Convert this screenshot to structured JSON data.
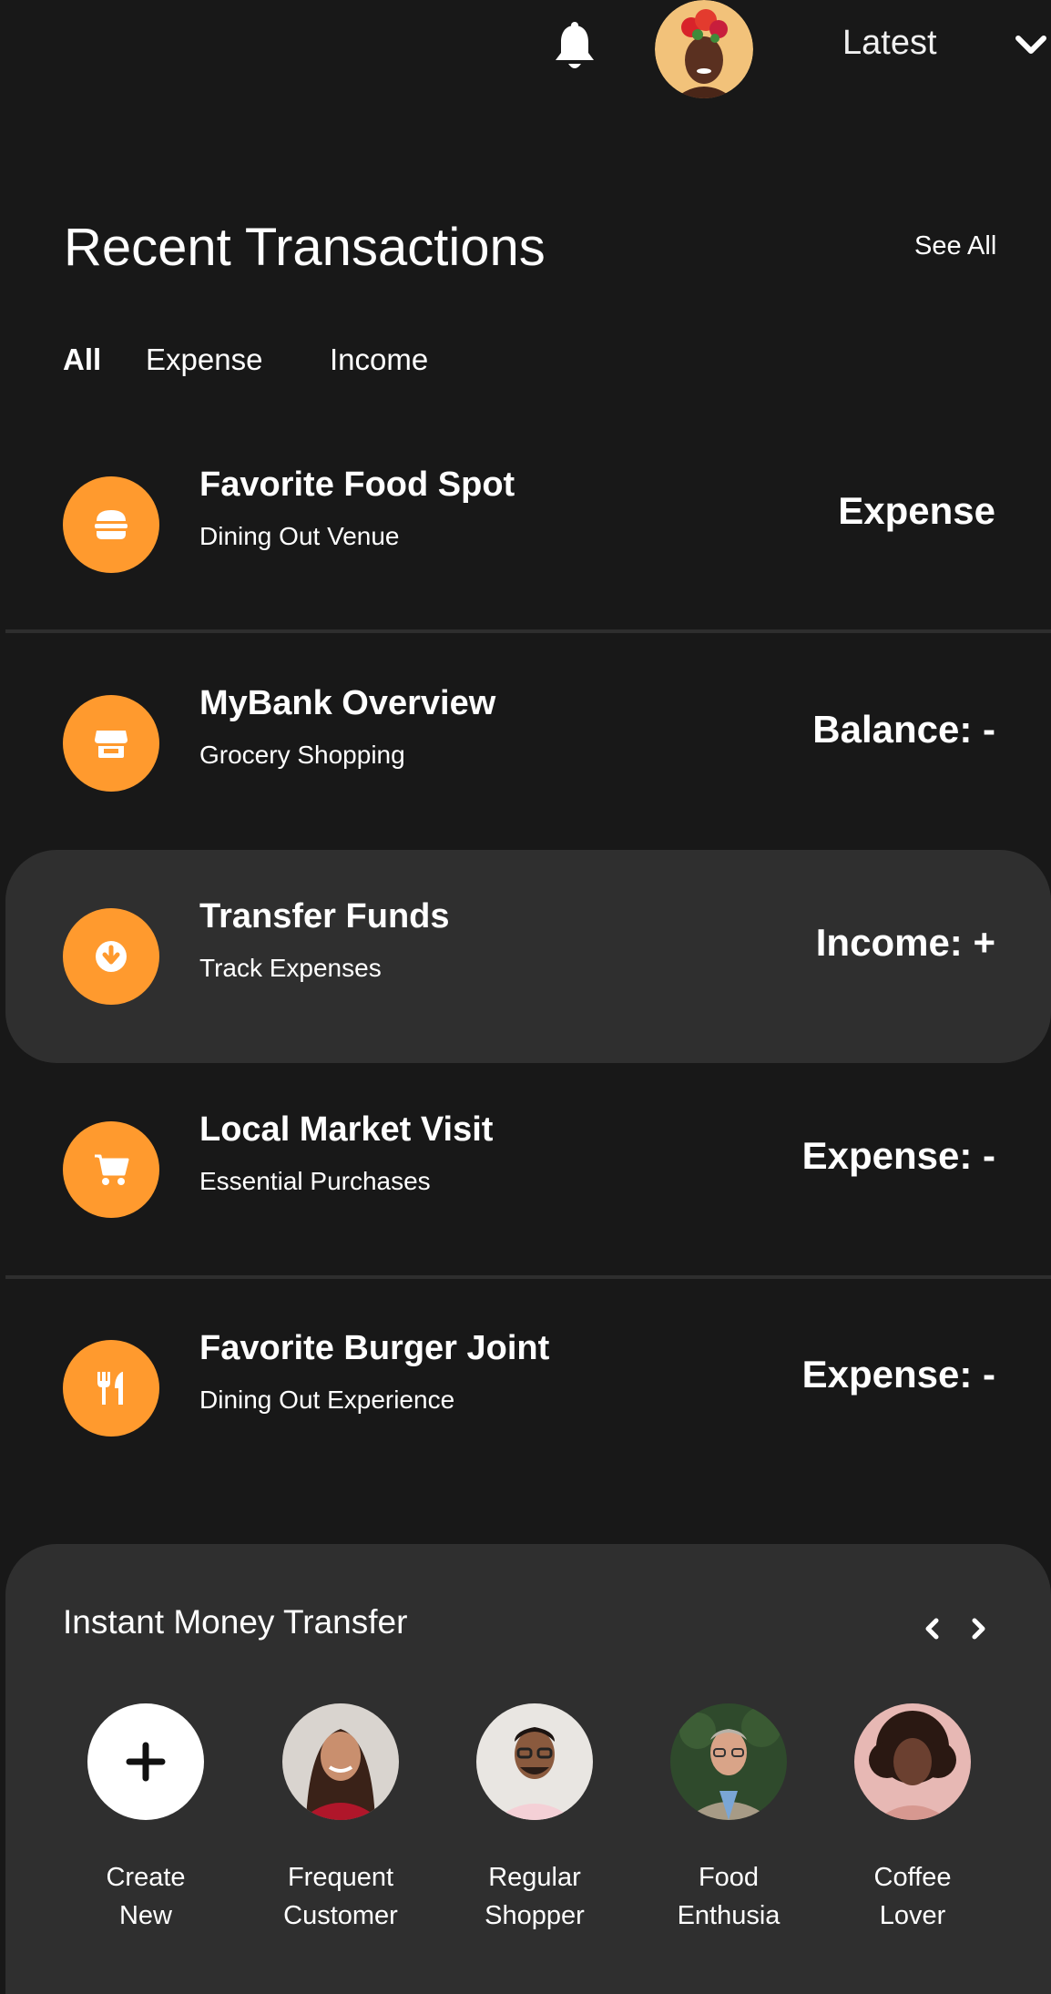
{
  "header": {
    "sort_label": "Latest"
  },
  "section": {
    "title": "Recent Transactions",
    "see_all": "See All"
  },
  "tabs": [
    {
      "label": "All",
      "active": true
    },
    {
      "label": "Expense",
      "active": false
    },
    {
      "label": "Income",
      "active": false
    }
  ],
  "transactions": [
    {
      "title": "Favorite Food Spot",
      "subtitle": "Dining Out Venue",
      "amount": "Expense",
      "icon": "burger-icon"
    },
    {
      "title": "MyBank Overview",
      "subtitle": "Grocery Shopping",
      "amount": "Balance: -",
      "icon": "store-icon"
    },
    {
      "title": "Transfer Funds",
      "subtitle": "Track Expenses",
      "amount": "Income: +",
      "icon": "download-circle-icon"
    },
    {
      "title": "Local Market Visit",
      "subtitle": "Essential Purchases",
      "amount": "Expense: -",
      "icon": "cart-icon"
    },
    {
      "title": "Favorite Burger Joint",
      "subtitle": "Dining Out Experience",
      "amount": "Expense: -",
      "icon": "utensils-icon"
    }
  ],
  "transfer": {
    "title": "Instant Money Transfer",
    "contacts": [
      {
        "line1": "Create",
        "line2": "New",
        "icon": "plus-icon"
      },
      {
        "line1": "Frequent",
        "line2": "Customer"
      },
      {
        "line1": "Regular",
        "line2": "Shopper"
      },
      {
        "line1": "Food",
        "line2": "Enthusia"
      },
      {
        "line1": "Coffee",
        "line2": "Lover"
      }
    ]
  },
  "colors": {
    "background": "#181818",
    "card": "#2f2f2f",
    "accent": "#ff9a2e",
    "text": "#ffffff"
  }
}
